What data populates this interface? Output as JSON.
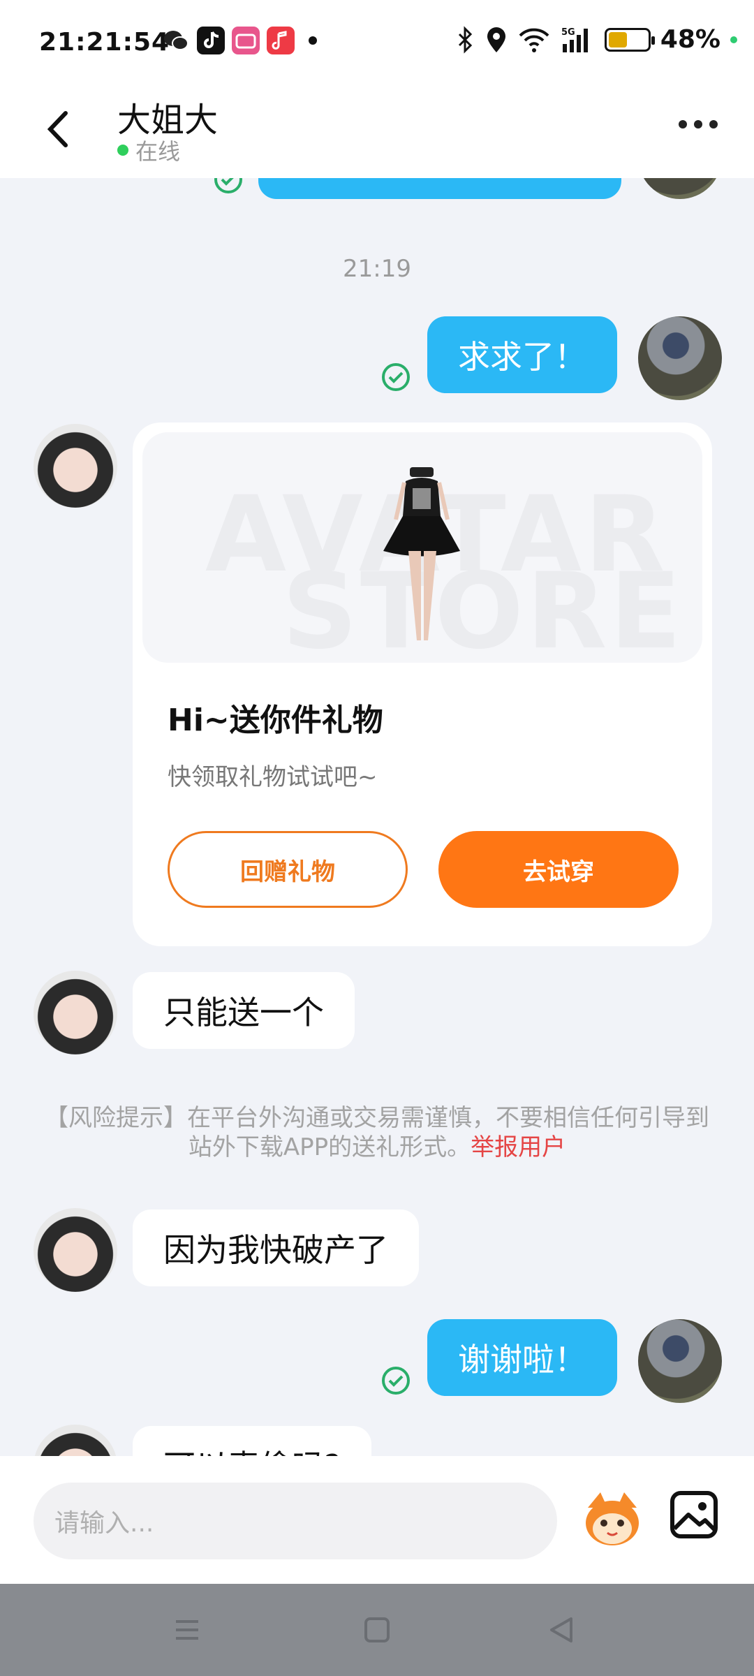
{
  "status_bar": {
    "time": "21:21:54",
    "battery": "48%",
    "battery_level": 0.48,
    "network": "5G"
  },
  "header": {
    "name": "大姐大",
    "status": "在线"
  },
  "chat": {
    "timestamp": "21:19",
    "msg_me_1": "求求了！",
    "gift": {
      "title": "Hi~送你件礼物",
      "subtitle": "快领取礼物试试吧~",
      "btn_return": "回赠礼物",
      "btn_try": "去试穿",
      "watermark_1": "AVATAR",
      "watermark_2": "STORE"
    },
    "msg_other_1": "只能送一个",
    "risk_notice": "【风险提示】在平台外沟通或交易需谨慎，不要相信任何引导到站外下载APP的送礼形式。",
    "risk_link": "举报用户",
    "msg_other_2": "因为我快破产了",
    "msg_me_2": "谢谢啦！",
    "msg_other_3": "可以麦偷吗?"
  },
  "input": {
    "placeholder": "请输入..."
  },
  "colors": {
    "bubble_me": "#2bb8f5",
    "accent_orange": "#ff7614",
    "online": "#2fcf5c",
    "risk_link": "#e54545"
  }
}
